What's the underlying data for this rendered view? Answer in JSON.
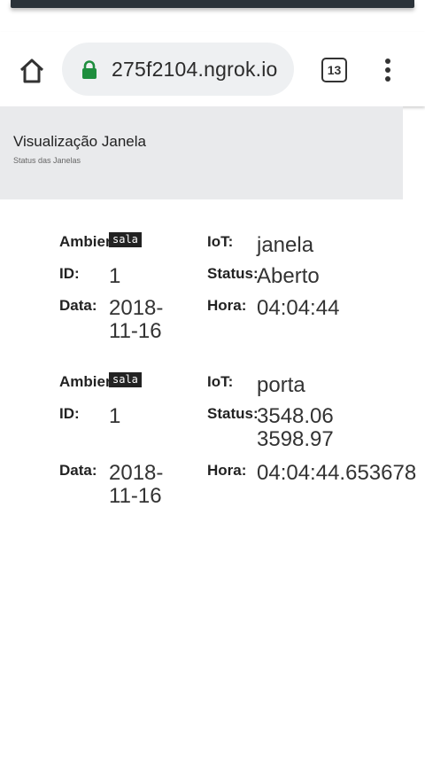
{
  "browser": {
    "url": "275f2104.ngrok.io",
    "tab_count": "13",
    "home_icon": "home-icon",
    "lock_icon": "lock-icon",
    "menu_icon": "more-vert-icon",
    "lock_color": "#1e8e3e"
  },
  "header": {
    "title": "Visualização Janela",
    "subtitle": "Status das Janelas"
  },
  "records": [
    {
      "ambiente_label": "Ambiente:",
      "ambiente": "sala",
      "iot_label": "IoT:",
      "iot": "janela",
      "id_label": "ID:",
      "id": "1",
      "status_label": "Status:",
      "status": "Aberto",
      "data_label": "Data:",
      "data": "2018-11-16",
      "hora_label": "Hora:",
      "hora": "04:04:44"
    },
    {
      "ambiente_label": "Ambiente:",
      "ambiente": "sala",
      "iot_label": "IoT:",
      "iot": "porta",
      "id_label": "ID:",
      "id": "1",
      "status_label": "Status:",
      "status": "3548.06 3598.97",
      "data_label": "Data:",
      "data": "2018-11-16",
      "hora_label": "Hora:",
      "hora": "04:04:44.653678"
    }
  ]
}
